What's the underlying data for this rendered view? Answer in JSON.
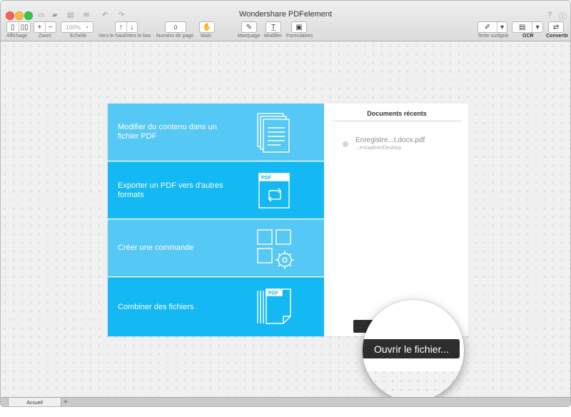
{
  "window": {
    "title": "Wondershare PDFelement"
  },
  "toolbar": {
    "zoom_value": "100%",
    "page_number": "0",
    "labels": {
      "affichage": "Affichage",
      "zoom": "Zoom",
      "echelle": "Echelle",
      "navigation": "Vers le haut/Vers le bas",
      "page_number": "Numéro de page",
      "main": "Main",
      "marquage": "Marquage",
      "modifier": "Modifier",
      "formulaires": "Formulaires",
      "texte_surligne": "Texte surligné",
      "ocr": "OCR",
      "convertir": "Convertir"
    },
    "zoom_in_symbol": "+",
    "zoom_out_symbol": "−"
  },
  "home": {
    "tiles": [
      {
        "label": "Modifier du contenu dans un fichier PDF",
        "icon": "document-stack-icon"
      },
      {
        "label": "Exporter un PDF vers d'autres formats",
        "icon": "pdf-convert-icon",
        "badge": "PDF"
      },
      {
        "label": "Créer une commande",
        "icon": "grid-gear-icon"
      },
      {
        "label": "Combiner des fichiers",
        "icon": "combine-files-icon",
        "badge": "PDF"
      }
    ],
    "recent": {
      "title": "Documents récents",
      "items": [
        {
          "name": "Enregistre...t.docx.pdf",
          "path": "...ers/admin/Desktop"
        }
      ]
    },
    "open_button_label": "Ouvrir le fichier..."
  },
  "tabs": {
    "active": "Accueil",
    "add_symbol": "+"
  },
  "colors": {
    "tile_light": "#56c8f5",
    "tile_dark": "#14b8f3",
    "button_dark": "#2d2d2d"
  }
}
